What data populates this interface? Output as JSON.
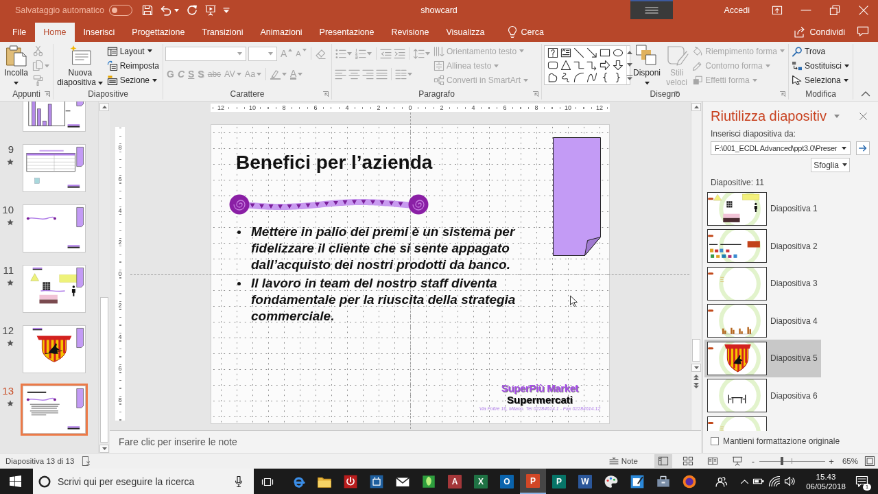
{
  "title_bar": {
    "autosave": {
      "label": "Salvataggio automatico",
      "on": false
    },
    "title": "showcard",
    "account": "Accedi"
  },
  "tabs": [
    {
      "label": "File",
      "selected": false
    },
    {
      "label": "Home",
      "selected": true
    },
    {
      "label": "Inserisci",
      "selected": false
    },
    {
      "label": "Progettazione",
      "selected": false
    },
    {
      "label": "Transizioni",
      "selected": false
    },
    {
      "label": "Animazioni",
      "selected": false
    },
    {
      "label": "Presentazione",
      "selected": false
    },
    {
      "label": "Revisione",
      "selected": false
    },
    {
      "label": "Visualizza",
      "selected": false
    }
  ],
  "tell_me": {
    "label": "Cerca"
  },
  "share": {
    "label": "Condividi"
  },
  "ribbon": {
    "groups": [
      {
        "label": "Appunti",
        "items": [
          {
            "kind": "large",
            "label": "Incolla",
            "dropdown": true,
            "disabled": false
          },
          {
            "kind": "tool",
            "disabled": true
          },
          {
            "kind": "tool",
            "dropdown": true,
            "disabled": true
          },
          {
            "kind": "tool",
            "disabled": true
          }
        ]
      },
      {
        "label": "Diapositive",
        "items": [
          {
            "kind": "large",
            "label": "Nuova diapositiva",
            "dropdown": true,
            "disabled": false
          },
          {
            "kind": "small",
            "label": "Layout",
            "dropdown": true,
            "disabled": false
          },
          {
            "kind": "small",
            "label": "Reimposta",
            "disabled": false
          },
          {
            "kind": "small",
            "label": "Sezione",
            "dropdown": true,
            "disabled": false
          }
        ]
      },
      {
        "label": "Carattere",
        "items": [
          {
            "kind": "field",
            "dropdown": true,
            "disabled": true
          },
          {
            "kind": "field",
            "dropdown": true,
            "disabled": true
          },
          {
            "kind": "tool",
            "label": "A",
            "disabled": true
          },
          {
            "kind": "tool",
            "label": "A",
            "disabled": true
          },
          {
            "kind": "tool",
            "disabled": true
          },
          {
            "kind": "tool",
            "label": "G",
            "disabled": true
          },
          {
            "kind": "tool",
            "label": "C",
            "disabled": true
          },
          {
            "kind": "tool",
            "label": "S",
            "disabled": true
          },
          {
            "kind": "tool",
            "label": "S",
            "disabled": true
          },
          {
            "kind": "tool",
            "label": "abc",
            "disabled": true
          },
          {
            "kind": "tool",
            "label": "AV",
            "dropdown": true,
            "disabled": true
          },
          {
            "kind": "tool",
            "label": "Aa",
            "dropdown": true,
            "disabled": true
          },
          {
            "kind": "tool",
            "dropdown": true,
            "disabled": true
          },
          {
            "kind": "tool",
            "label": "A",
            "dropdown": true,
            "disabled": true
          }
        ]
      },
      {
        "label": "Paragrafo",
        "items": [
          {
            "kind": "tool",
            "dropdown": true,
            "disabled": true
          },
          {
            "kind": "tool",
            "dropdown": true,
            "disabled": true
          },
          {
            "kind": "tool",
            "disabled": true
          },
          {
            "kind": "tool",
            "disabled": true
          },
          {
            "kind": "tool",
            "dropdown": true,
            "disabled": true
          },
          {
            "kind": "small",
            "label": "Orientamento testo",
            "dropdown": true,
            "disabled": true
          },
          {
            "kind": "small",
            "label": "Allinea testo",
            "dropdown": true,
            "disabled": true
          },
          {
            "kind": "small",
            "label": "Converti in SmartArt",
            "dropdown": true,
            "disabled": true
          },
          {
            "kind": "tool",
            "disabled": true
          },
          {
            "kind": "tool",
            "disabled": true
          },
          {
            "kind": "tool",
            "disabled": true
          },
          {
            "kind": "tool",
            "disabled": true
          },
          {
            "kind": "tool",
            "dropdown": true,
            "disabled": true
          }
        ]
      },
      {
        "label": "Disegno",
        "items": [
          {
            "kind": "gallery",
            "disabled": false
          },
          {
            "kind": "large",
            "label": "Disponi",
            "dropdown": true,
            "disabled": false
          },
          {
            "kind": "large",
            "label": "Stili veloci",
            "dropdown": true,
            "disabled": true
          },
          {
            "kind": "small",
            "label": "Riempimento forma",
            "dropdown": true,
            "disabled": true
          },
          {
            "kind": "small",
            "label": "Contorno forma",
            "dropdown": true,
            "disabled": true
          },
          {
            "kind": "small",
            "label": "Effetti forma",
            "dropdown": true,
            "disabled": true
          }
        ]
      },
      {
        "label": "Modifica",
        "items": [
          {
            "kind": "small",
            "label": "Trova",
            "disabled": false
          },
          {
            "kind": "small",
            "label": "Sostituisci",
            "dropdown": true,
            "disabled": false
          },
          {
            "kind": "small",
            "label": "Seleziona",
            "dropdown": true,
            "disabled": false
          }
        ]
      }
    ]
  },
  "slides_pane": {
    "slides": [
      {
        "kind": "chart",
        "selected": false
      },
      {
        "number": "9",
        "kind": "table",
        "selected": false,
        "animated": true
      },
      {
        "number": "10",
        "kind": "wave",
        "selected": false,
        "animated": true
      },
      {
        "number": "11",
        "kind": "shapes",
        "selected": false,
        "animated": true
      },
      {
        "number": "12",
        "kind": "crest",
        "selected": false,
        "animated": true
      },
      {
        "number": "13",
        "kind": "text",
        "selected": true,
        "animated": true
      }
    ]
  },
  "rulers": {
    "horizontal": [
      "12",
      "10",
      "8",
      "6",
      "4",
      "2",
      "0",
      "2",
      "4",
      "6",
      "8",
      "10",
      "12"
    ],
    "vertical": [
      "8",
      "6",
      "4",
      "2",
      "0",
      "2",
      "4",
      "6",
      "8"
    ]
  },
  "slide": {
    "title": "Benefici per l’azienda",
    "bullets": [
      "Mettere in palio dei premi è un sistema per fidelizzare il cliente che si sente appagato dall’acquisto dei nostri prodotti da banco.",
      "Il lavoro in team del nostro staff diventa fondamentale per la riuscita della strategia commerciale."
    ],
    "logo": {
      "brand": "SuperPiù Market",
      "tagline": "Supermercati",
      "address": "Via Foltre 16, Milano. Tel 02284614.1 - Fax 02284614.12"
    }
  },
  "notes": {
    "placeholder": "Fare clic per inserire le note"
  },
  "reuse_pane": {
    "title": "Riutilizza diapositiv",
    "source_label": "Inserisci diapositiva da:",
    "source_path": "F:\\001_ECDL Advanced\\ppt3.0\\Preser",
    "browse": "Sfoglia",
    "count": "Diapositive: 11",
    "slides": [
      {
        "label": "Diapositiva 1",
        "kind": "shapes",
        "selected": false
      },
      {
        "label": "Diapositiva 2",
        "kind": "screenshot",
        "selected": false
      },
      {
        "label": "Diapositiva 3",
        "kind": "blank",
        "selected": false
      },
      {
        "label": "Diapositiva 4",
        "kind": "chart",
        "selected": false
      },
      {
        "label": "Diapositiva 5",
        "kind": "crest",
        "selected": true
      },
      {
        "label": "Diapositiva 6",
        "kind": "furniture",
        "selected": false
      },
      {
        "kind": "blank",
        "selected": false
      }
    ],
    "keep_formatting": {
      "label": "Mantieni formattazione originale",
      "checked": false
    }
  },
  "status_bar": {
    "slide_info": "Diapositiva 13 di 13",
    "notes": "Note",
    "views": [
      {
        "kind": "normal",
        "selected": true
      },
      {
        "kind": "sorter",
        "selected": false
      },
      {
        "kind": "reading",
        "selected": false
      },
      {
        "kind": "slideshow",
        "selected": false
      }
    ],
    "zoom_out": "-",
    "zoom": {
      "level": 0.34
    },
    "zoom_in": "+",
    "zoom_value": "65%"
  },
  "taskbar": {
    "search": {
      "placeholder": "Scrivi qui per eseguire la ricerca"
    },
    "apps": [
      {
        "kind": "browser",
        "selected": false
      },
      {
        "kind": "folder",
        "selected": false
      },
      {
        "kind": "power",
        "selected": false
      },
      {
        "kind": "control",
        "selected": false
      },
      {
        "kind": "mail",
        "selected": false
      },
      {
        "kind": "leaf",
        "selected": false
      },
      {
        "kind": "access",
        "glyph": "A",
        "selected": false
      },
      {
        "kind": "excel",
        "glyph": "X",
        "selected": false
      },
      {
        "kind": "outlook",
        "glyph": "O",
        "selected": false
      },
      {
        "kind": "powerpoint",
        "glyph": "P",
        "selected": true
      },
      {
        "kind": "publisher",
        "glyph": "P",
        "selected": false
      },
      {
        "kind": "word",
        "glyph": "W",
        "selected": false
      },
      {
        "kind": "palette",
        "selected": false
      },
      {
        "kind": "sticky",
        "selected": false
      },
      {
        "kind": "device",
        "selected": false
      },
      {
        "kind": "firefox",
        "selected": false
      }
    ],
    "time": "15.43",
    "date": "06/05/2018",
    "notifications": "1"
  }
}
